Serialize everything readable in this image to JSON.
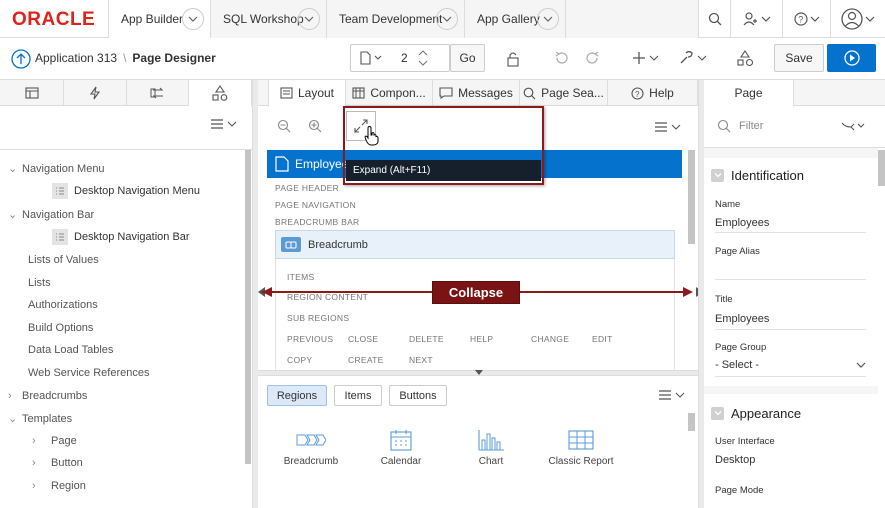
{
  "header": {
    "logo": "ORACLE",
    "tabs": [
      {
        "label": "App Builder"
      },
      {
        "label": "SQL Workshop"
      },
      {
        "label": "Team Development"
      },
      {
        "label": "App Gallery"
      }
    ]
  },
  "toolbar": {
    "breadcrumb_app": "Application 313",
    "breadcrumb_sep": "\\",
    "breadcrumb_page": "Page Designer",
    "page_number": "2",
    "go_label": "Go",
    "save_label": "Save"
  },
  "left_panel": {
    "tree": [
      {
        "label": "Navigation Menu",
        "level": 0,
        "arrow": "v"
      },
      {
        "label": "Desktop Navigation Menu",
        "level": 1
      },
      {
        "label": "Navigation Bar",
        "level": 0,
        "arrow": "v"
      },
      {
        "label": "Desktop Navigation Bar",
        "level": 1
      },
      {
        "label": "Lists of Values",
        "level": 0
      },
      {
        "label": "Lists",
        "level": 0
      },
      {
        "label": "Authorizations",
        "level": 0
      },
      {
        "label": "Build Options",
        "level": 0
      },
      {
        "label": "Data Load Tables",
        "level": 0
      },
      {
        "label": "Web Service References",
        "level": 0
      },
      {
        "label": "Breadcrumbs",
        "level": 0,
        "arrow": ">"
      },
      {
        "label": "Templates",
        "level": 0,
        "arrow": "v"
      },
      {
        "label": "Page",
        "level": 1,
        "arrow": ">"
      },
      {
        "label": "Button",
        "level": 1,
        "arrow": ">"
      },
      {
        "label": "Region",
        "level": 1,
        "arrow": ">"
      }
    ]
  },
  "center": {
    "tabs": [
      {
        "label": "Layout"
      },
      {
        "label": "Compon..."
      },
      {
        "label": "Messages"
      },
      {
        "label": "Page Sea..."
      },
      {
        "label": "Help"
      }
    ],
    "tooltip": "Expand (Alt+F11)",
    "page_title": "Employee",
    "positions": [
      "PAGE HEADER",
      "PAGE NAVIGATION",
      "BREADCRUMB BAR"
    ],
    "breadcrumb_region": "Breadcrumb",
    "sub_positions": [
      "ITEMS",
      "REGION CONTENT",
      "SUB REGIONS"
    ],
    "buttons_row1": [
      "PREVIOUS",
      "CLOSE",
      "DELETE",
      "HELP",
      "CHANGE",
      "EDIT"
    ],
    "buttons_row2": [
      "COPY",
      "CREATE",
      "NEXT"
    ],
    "collapse_label": "Collapse",
    "gallery_tabs": [
      "Regions",
      "Items",
      "Buttons"
    ],
    "gallery_items": [
      "Breadcrumb",
      "Calendar",
      "Chart",
      "Classic Report"
    ]
  },
  "right_panel": {
    "tab": "Page",
    "filter_placeholder": "Filter",
    "identification_label": "Identification",
    "name_label": "Name",
    "name_value": "Employees",
    "page_alias_label": "Page Alias",
    "title_label": "Title",
    "title_value": "Employees",
    "page_group_label": "Page Group",
    "page_group_value": "- Select -",
    "appearance_label": "Appearance",
    "ui_label": "User Interface",
    "ui_value": "Desktop",
    "page_mode_label": "Page Mode"
  },
  "colors": {
    "oracle_red": "#e0221b",
    "accent_blue": "#0572ce",
    "highlight_border": "#8b1a1a",
    "collapse_bg": "#7a1414"
  }
}
